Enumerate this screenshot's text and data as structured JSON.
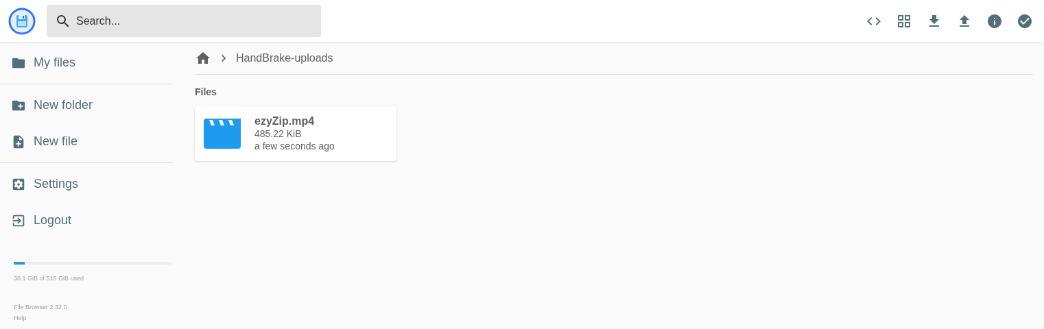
{
  "search": {
    "placeholder": "Search..."
  },
  "sidebar": {
    "sections": [
      {
        "items": [
          {
            "label": "My files"
          }
        ]
      },
      {
        "items": [
          {
            "label": "New folder"
          },
          {
            "label": "New file"
          }
        ]
      },
      {
        "items": [
          {
            "label": "Settings"
          },
          {
            "label": "Logout"
          }
        ]
      }
    ]
  },
  "storage": {
    "level": 0.07,
    "reading": "36.1 GiB of 515 GiB used"
  },
  "footer": {
    "version": "File Browser 2.32.0",
    "help": "Help"
  },
  "breadcrumb": {
    "path": "HandBrake-uploads"
  },
  "files_heading": "Files",
  "files": [
    {
      "name": "ezyZip.mp4",
      "size": "485.22 KiB",
      "modified": "a few seconds ago"
    }
  ]
}
